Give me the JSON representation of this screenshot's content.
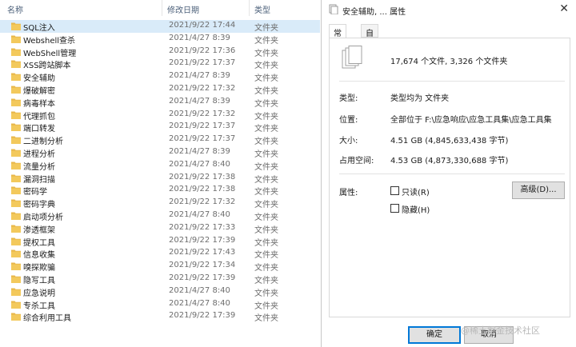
{
  "explorer": {
    "columns": {
      "name": "名称",
      "date": "修改日期",
      "type": "类型"
    },
    "rows": [
      {
        "name": "SQL注入",
        "date": "2021/9/22 17:44",
        "type": "文件夹",
        "selected": true
      },
      {
        "name": "Webshell查杀",
        "date": "2021/4/27 8:39",
        "type": "文件夹"
      },
      {
        "name": "WebShell管理",
        "date": "2021/9/22 17:36",
        "type": "文件夹"
      },
      {
        "name": "XSS跨站脚本",
        "date": "2021/9/22 17:37",
        "type": "文件夹"
      },
      {
        "name": "安全辅助",
        "date": "2021/4/27 8:39",
        "type": "文件夹"
      },
      {
        "name": "爆破解密",
        "date": "2021/9/22 17:32",
        "type": "文件夹"
      },
      {
        "name": "病毒样本",
        "date": "2021/4/27 8:39",
        "type": "文件夹"
      },
      {
        "name": "代理抓包",
        "date": "2021/9/22 17:32",
        "type": "文件夹"
      },
      {
        "name": "端口转发",
        "date": "2021/9/22 17:37",
        "type": "文件夹"
      },
      {
        "name": "二进制分析",
        "date": "2021/9/22 17:37",
        "type": "文件夹"
      },
      {
        "name": "进程分析",
        "date": "2021/4/27 8:39",
        "type": "文件夹"
      },
      {
        "name": "流量分析",
        "date": "2021/4/27 8:40",
        "type": "文件夹"
      },
      {
        "name": "漏洞扫描",
        "date": "2021/9/22 17:38",
        "type": "文件夹"
      },
      {
        "name": "密码学",
        "date": "2021/9/22 17:38",
        "type": "文件夹"
      },
      {
        "name": "密码字典",
        "date": "2021/9/22 17:32",
        "type": "文件夹"
      },
      {
        "name": "启动项分析",
        "date": "2021/4/27 8:40",
        "type": "文件夹"
      },
      {
        "name": "渗透框架",
        "date": "2021/9/22 17:33",
        "type": "文件夹"
      },
      {
        "name": "提权工具",
        "date": "2021/9/22 17:39",
        "type": "文件夹"
      },
      {
        "name": "信息收集",
        "date": "2021/9/22 17:43",
        "type": "文件夹"
      },
      {
        "name": "嗅探欺骗",
        "date": "2021/9/22 17:34",
        "type": "文件夹"
      },
      {
        "name": "隐写工具",
        "date": "2021/9/22 17:39",
        "type": "文件夹"
      },
      {
        "name": "应急说明",
        "date": "2021/4/27 8:40",
        "type": "文件夹"
      },
      {
        "name": "专杀工具",
        "date": "2021/4/27 8:40",
        "type": "文件夹"
      },
      {
        "name": "综合利用工具",
        "date": "2021/9/22 17:39",
        "type": "文件夹"
      }
    ]
  },
  "dialog": {
    "title": "安全辅助, ... 属性",
    "close_glyph": "✕",
    "tabs": [
      {
        "label": "常规",
        "active": true
      },
      {
        "label": "自定义"
      }
    ],
    "summary": "17,674 个文件, 3,326 个文件夹",
    "properties": {
      "type_label": "类型:",
      "type_value": "类型均为 文件夹",
      "location_label": "位置:",
      "location_value": "全部位于 F:\\应急响应\\应急工具集\\应急工具集",
      "size_label": "大小:",
      "size_value": "4.51 GB (4,845,633,438 字节)",
      "disk_label": "占用空间:",
      "disk_value": "4.53 GB (4,873,330,688 字节)"
    },
    "attributes": {
      "label": "属性:",
      "readonly": "只读(R)",
      "hidden": "隐藏(H)",
      "advanced_button": "高级(D)..."
    },
    "buttons": {
      "ok": "确定",
      "cancel": "取消"
    }
  },
  "colors": {
    "folder": "#e8b74a",
    "selection": "#d9ebf9",
    "accent": "#0078d7"
  },
  "watermark": "@稀土掘金技术社区"
}
